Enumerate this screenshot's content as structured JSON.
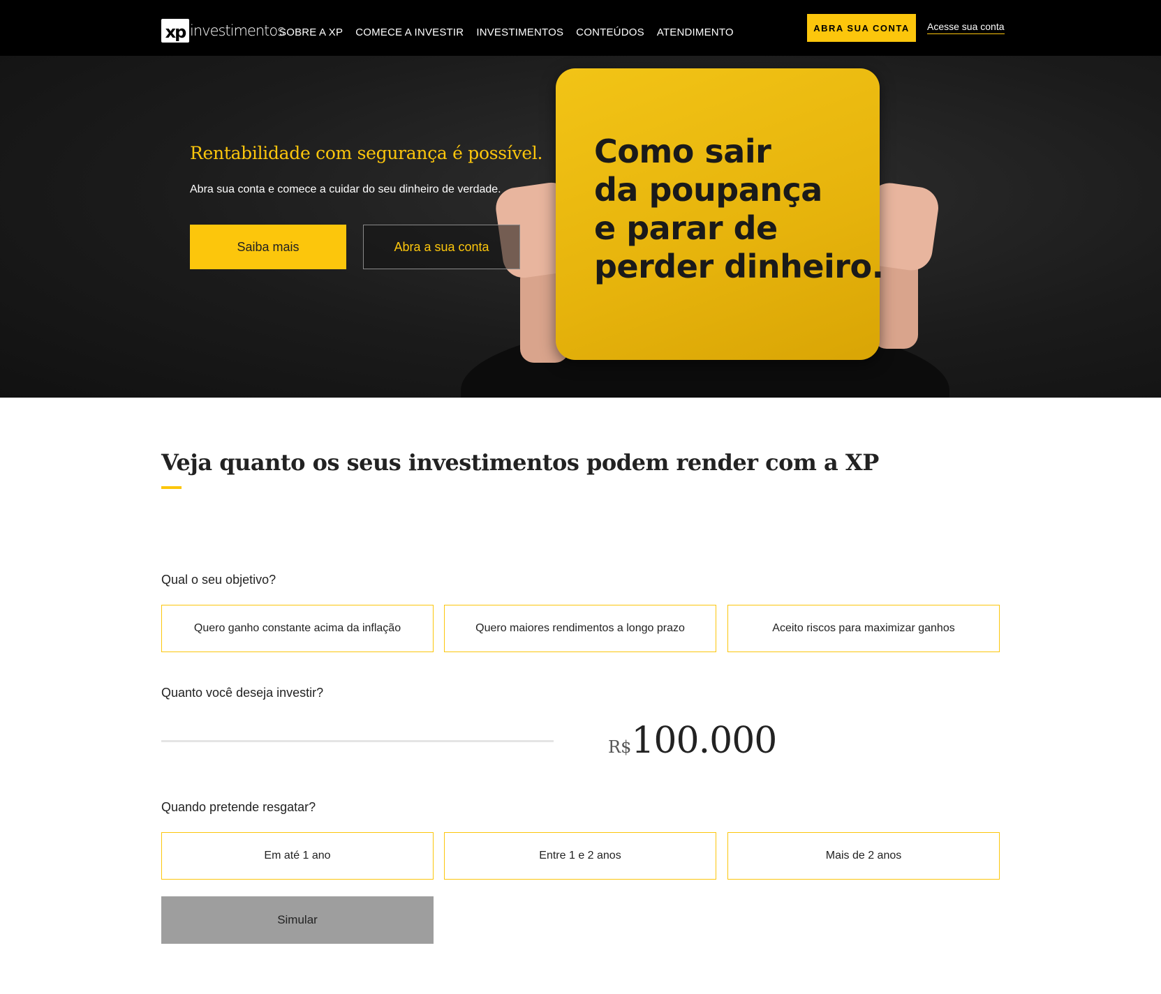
{
  "nav": {
    "logo_mark": "xp",
    "logo_text": "investimentos",
    "links": [
      "SOBRE A XP",
      "COMECE A INVESTIR",
      "INVESTIMENTOS",
      "CONTEÚDOS",
      "ATENDIMENTO"
    ],
    "open_account_label": "ABRA SUA CONTA",
    "access_account_label": "Acesse sua conta"
  },
  "hero": {
    "title": "Rentabilidade com segurança é possível.",
    "subtitle": "Abra sua conta e comece a cuidar do seu dinheiro de verdade.",
    "primary_button": "Saiba mais",
    "secondary_button": "Abra a sua conta",
    "sign_lines": [
      "Como sair",
      "da poupança",
      "e parar de",
      "perder dinheiro."
    ]
  },
  "simulator": {
    "title": "Veja quanto os seus investimentos podem render com a XP",
    "objective_question": "Qual o seu objetivo?",
    "objective_options": [
      "Quero ganho constante acima da inflação",
      "Quero maiores rendimentos a longo prazo",
      "Aceito riscos para maximizar ganhos"
    ],
    "amount_question": "Quanto você deseja investir?",
    "currency": "R$",
    "amount": "100.000",
    "redeem_question": "Quando pretende resgatar?",
    "redeem_options": [
      "Em até 1 ano",
      "Entre 1 e 2 anos",
      "Mais de 2 anos"
    ],
    "simulate_button": "Simular"
  },
  "colors": {
    "brand_yellow": "#fcc60c",
    "navbar_bg": "#000000",
    "simulate_button_bg": "#9e9e9e"
  }
}
